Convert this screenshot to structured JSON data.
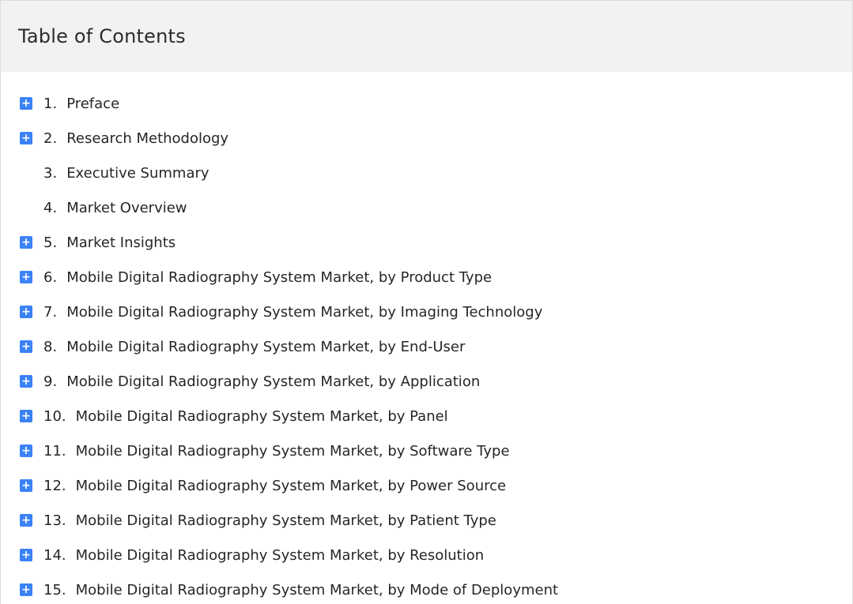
{
  "header": {
    "title": "Table of Contents"
  },
  "toc": {
    "items": [
      {
        "number": "1.",
        "label": "Preface",
        "expandable": true
      },
      {
        "number": "2.",
        "label": "Research Methodology",
        "expandable": true
      },
      {
        "number": "3.",
        "label": "Executive Summary",
        "expandable": false
      },
      {
        "number": "4.",
        "label": "Market Overview",
        "expandable": false
      },
      {
        "number": "5.",
        "label": "Market Insights",
        "expandable": true
      },
      {
        "number": "6.",
        "label": "Mobile Digital Radiography System Market, by Product Type",
        "expandable": true
      },
      {
        "number": "7.",
        "label": "Mobile Digital Radiography System Market, by Imaging Technology",
        "expandable": true
      },
      {
        "number": "8.",
        "label": "Mobile Digital Radiography System Market, by End-User",
        "expandable": true
      },
      {
        "number": "9.",
        "label": "Mobile Digital Radiography System Market, by Application",
        "expandable": true
      },
      {
        "number": "10.",
        "label": "Mobile Digital Radiography System Market, by Panel",
        "expandable": true
      },
      {
        "number": "11.",
        "label": "Mobile Digital Radiography System Market, by Software Type",
        "expandable": true
      },
      {
        "number": "12.",
        "label": "Mobile Digital Radiography System Market, by Power Source",
        "expandable": true
      },
      {
        "number": "13.",
        "label": "Mobile Digital Radiography System Market, by Patient Type",
        "expandable": true
      },
      {
        "number": "14.",
        "label": "Mobile Digital Radiography System Market, by Resolution",
        "expandable": true
      },
      {
        "number": "15.",
        "label": "Mobile Digital Radiography System Market, by Mode of Deployment",
        "expandable": true
      }
    ],
    "expand_glyph": "+",
    "expand_icon_color": "#3b82f6"
  }
}
